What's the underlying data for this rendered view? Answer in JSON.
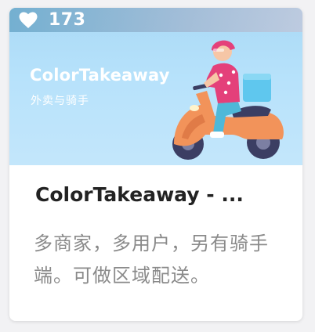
{
  "card": {
    "likes": "173",
    "banner_title": "ColorTakeaway",
    "banner_subtitle": "外卖与骑手",
    "title": "ColorTakeaway - ...",
    "description": "多商家，多用户，另有骑手端。可做区域配送。"
  },
  "icons": {
    "like": "heart-icon",
    "illustration": "scooter-rider-illustration"
  },
  "colors": {
    "banner_bg": "#b7e2fb",
    "title": "#222222",
    "description": "#8a8a8a"
  }
}
